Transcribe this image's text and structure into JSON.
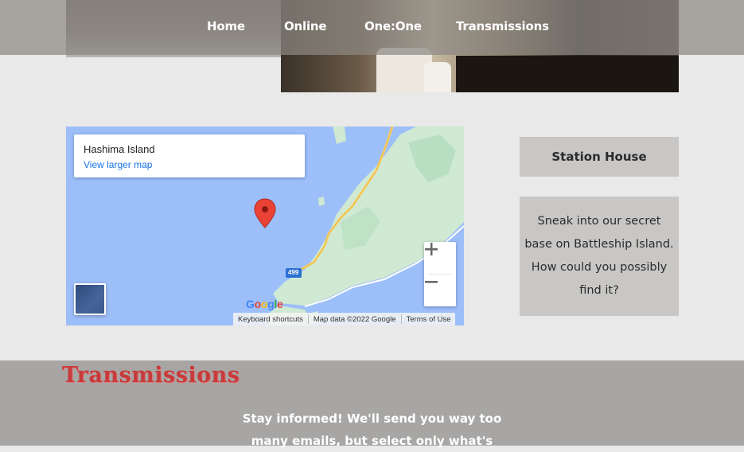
{
  "nav": {
    "items": [
      "Home",
      "Online",
      "One:One",
      "Transmissions"
    ]
  },
  "map": {
    "place_title": "Hashima Island",
    "larger_map_link": "View larger map",
    "road_number": "499",
    "logo_text": "Google",
    "footer": {
      "keyboard": "Keyboard shortcuts",
      "data": "Map data ©2022 Google",
      "terms": "Terms of Use"
    },
    "zoom_in_icon": "plus-icon",
    "zoom_out_icon": "minus-icon",
    "pin_icon": "map-pin-icon",
    "colors": {
      "water": "#9cbef9",
      "land": "#cfe9d3",
      "road": "#f7d36a",
      "pin": "#ea4335"
    }
  },
  "sidebar": {
    "title": "Station House",
    "description": "Sneak into our secret base on Battleship Island. How could you possibly find it?"
  },
  "transmissions": {
    "title": "Transmissions",
    "text": "Stay informed! We'll send you way too many emails, but select only what's"
  }
}
